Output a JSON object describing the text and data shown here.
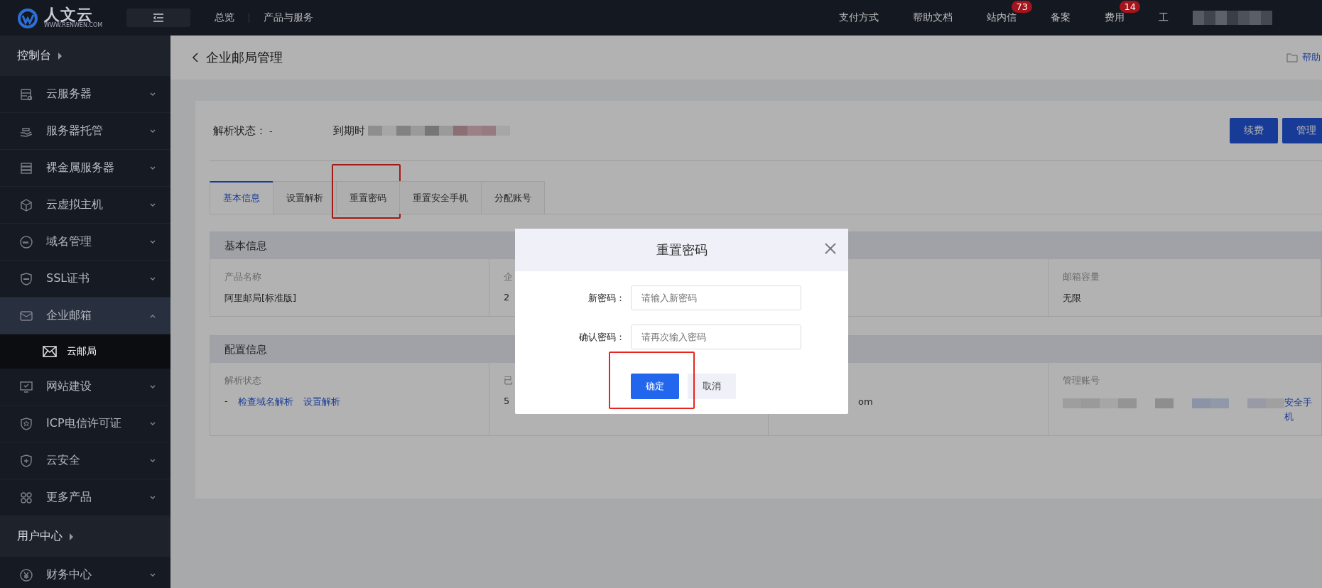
{
  "topbar": {
    "logo_text": "人文云",
    "logo_sub": "WWW.RENWEN.COM",
    "nav": [
      "总览",
      "产品与服务"
    ],
    "links": [
      {
        "label": "支付方式"
      },
      {
        "label": "帮助文档"
      },
      {
        "label": "站内信",
        "badge": "73"
      },
      {
        "label": "备案"
      },
      {
        "label": "费用",
        "badge": "14"
      },
      {
        "label": "工"
      }
    ]
  },
  "sidebar": {
    "items": [
      {
        "kind": "heading",
        "label": "控制台"
      },
      {
        "kind": "item",
        "label": "云服务器",
        "expanded": false
      },
      {
        "kind": "item",
        "label": "服务器托管",
        "expanded": false
      },
      {
        "kind": "item",
        "label": "裸金属服务器",
        "expanded": false
      },
      {
        "kind": "item",
        "label": "云虚拟主机",
        "expanded": false
      },
      {
        "kind": "item",
        "label": "域名管理",
        "expanded": false
      },
      {
        "kind": "item",
        "label": "SSL证书",
        "expanded": false
      },
      {
        "kind": "item",
        "label": "企业邮箱",
        "expanded": true,
        "children": [
          {
            "label": "云邮局",
            "selected": true
          }
        ]
      },
      {
        "kind": "item",
        "label": "网站建设",
        "expanded": false
      },
      {
        "kind": "item",
        "label": "ICP电信许可证",
        "expanded": false
      },
      {
        "kind": "item",
        "label": "云安全",
        "expanded": false
      },
      {
        "kind": "item",
        "label": "更多产品",
        "expanded": false
      },
      {
        "kind": "heading",
        "label": "用户中心"
      },
      {
        "kind": "item",
        "label": "财务中心",
        "expanded": false
      }
    ]
  },
  "page": {
    "title": "企业邮局管理",
    "help": "帮助",
    "status_label": "解析状态：",
    "status_value": "-",
    "expiry_label": "到期时",
    "buttons": [
      "续费",
      "管理"
    ],
    "tabs": [
      {
        "label": "基本信息",
        "selected": true
      },
      {
        "label": "设置解析",
        "selected": false
      },
      {
        "label": "重置密码",
        "selected": false,
        "highlighted": true
      },
      {
        "label": "重置安全手机",
        "selected": false
      },
      {
        "label": "分配账号",
        "selected": false
      }
    ],
    "sections": [
      {
        "title": "基本信息",
        "cells": [
          {
            "label": "产品名称",
            "value": "阿里邮局[标准版]"
          },
          {
            "label": "企",
            "value": "2"
          },
          {},
          {
            "label": "邮箱容量",
            "value": "无限"
          }
        ]
      },
      {
        "title": "配置信息",
        "cells": [
          {
            "label": "解析状态",
            "value": "-",
            "links": [
              "检查域名解析",
              "设置解析"
            ]
          },
          {
            "label": "已",
            "value": "5"
          },
          {
            "value": "om"
          },
          {
            "label": "管理账号",
            "redacted": true,
            "link": "安全手机"
          }
        ]
      }
    ]
  },
  "modal": {
    "title": "重置密码",
    "fields": [
      {
        "label": "新密码：",
        "placeholder": "请输入新密码"
      },
      {
        "label": "确认密码：",
        "placeholder": "请再次输入密码"
      }
    ],
    "confirm": {
      "label": "确定",
      "highlighted": true
    },
    "cancel": "取消"
  }
}
